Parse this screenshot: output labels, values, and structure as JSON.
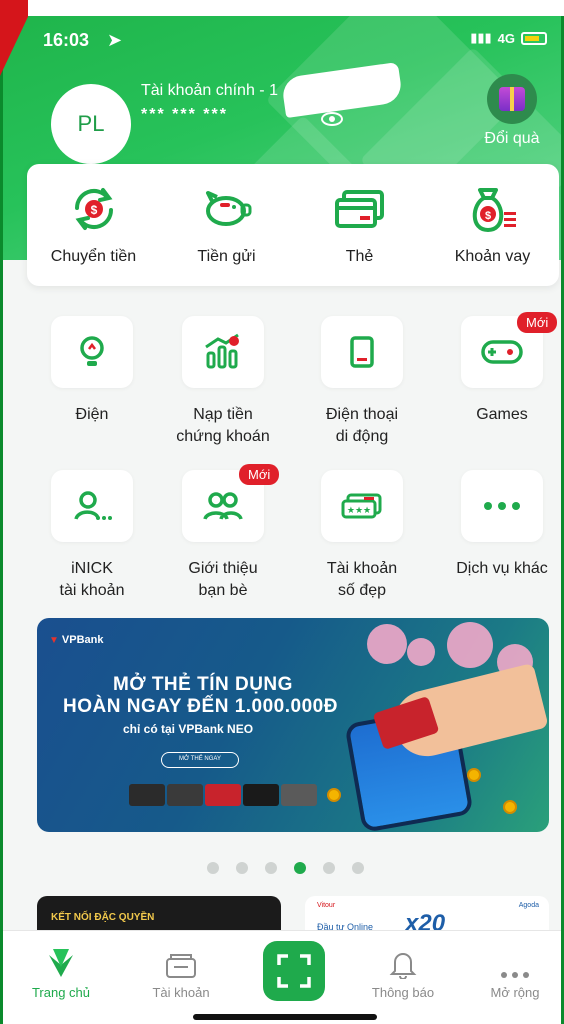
{
  "status_bar": {
    "time": "16:03",
    "network": "4G"
  },
  "account": {
    "avatar_initials": "PL",
    "name": "Tài khoản chính - 1",
    "masked_number": "*** *** ***",
    "gift_label": "Đổi quà"
  },
  "quick_actions": [
    {
      "label": "Chuyển tiền",
      "icon": "transfer-icon"
    },
    {
      "label": "Tiền gửi",
      "icon": "piggy-bank-icon"
    },
    {
      "label": "Thẻ",
      "icon": "card-icon"
    },
    {
      "label": "Khoản vay",
      "icon": "loan-bag-icon"
    }
  ],
  "services": [
    {
      "line1": "Điện",
      "line2": "",
      "icon": "lightbulb-icon"
    },
    {
      "line1": "Nạp tiền",
      "line2": "chứng khoán",
      "icon": "stock-chart-icon"
    },
    {
      "line1": "Điện thoại",
      "line2": "di động",
      "icon": "mobile-phone-icon"
    },
    {
      "line1": "Games",
      "line2": "",
      "icon": "gamepad-icon",
      "badge": "Mới"
    },
    {
      "line1": "iNICK",
      "line2": "tài khoản",
      "icon": "user-icon"
    },
    {
      "line1": "Giới thiệu",
      "line2": "bạn bè",
      "icon": "friends-icon",
      "badge": "Mới"
    },
    {
      "line1": "Tài khoản",
      "line2": "số đẹp",
      "icon": "beautiful-number-icon"
    },
    {
      "line1": "Dịch vụ khác",
      "line2": "",
      "icon": "more-dots-icon"
    }
  ],
  "banner": {
    "brand": "VPBank",
    "headline1": "MỞ THẺ TÍN DỤNG",
    "headline2": "HOÀN NGAY ĐẾN 1.000.000Đ",
    "subline": "chỉ có tại VPBank NEO",
    "cta": "MỞ THẺ NGAY"
  },
  "carousel": {
    "count": 6,
    "active_index": 3
  },
  "promos": {
    "left_text_a": "KẾT NỐI",
    "left_text_b": "ĐẶC QUYỀN",
    "right_logo_left": "Vitour",
    "right_logo_right": "Agoda",
    "right_text": "Đầu tư Online",
    "right_multiplier": "x20"
  },
  "tabs": [
    {
      "label": "Trang chủ",
      "icon": "home-leaf-icon",
      "active": true
    },
    {
      "label": "Tài khoản",
      "icon": "wallet-icon",
      "active": false
    },
    {
      "label": "",
      "icon": "scan-qr-icon",
      "active": false
    },
    {
      "label": "Thông báo",
      "icon": "bell-icon",
      "active": false
    },
    {
      "label": "Mở rộng",
      "icon": "more-icon",
      "active": false
    }
  ],
  "colors": {
    "primary_green": "#1faa4c",
    "badge_red": "#e0202a"
  }
}
